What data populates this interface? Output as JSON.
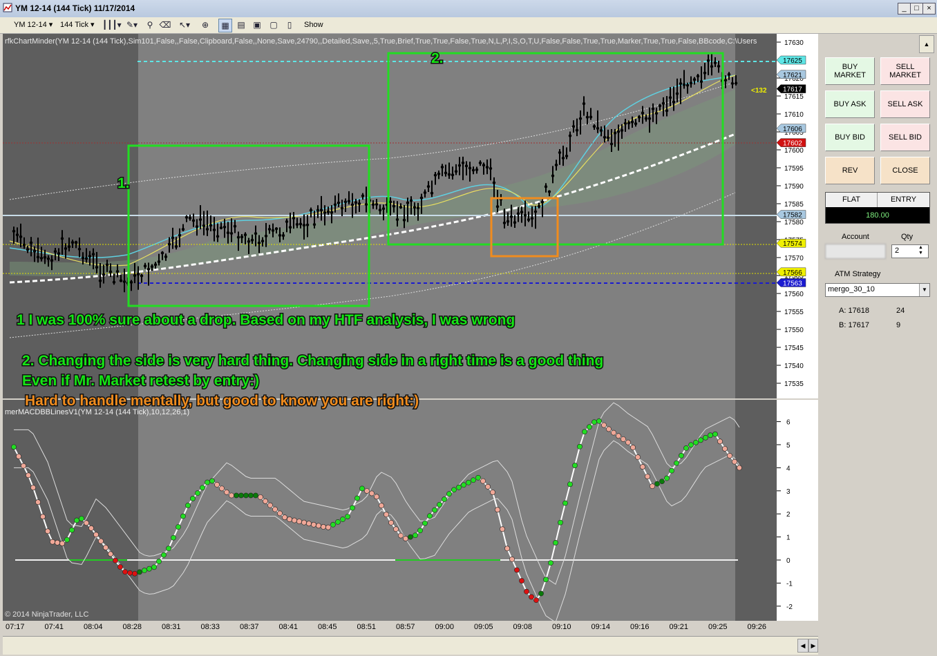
{
  "window": {
    "title": "YM 12-14 (144 Tick)  11/17/2014",
    "controls": [
      "_",
      "□",
      "×"
    ]
  },
  "toolbar": {
    "instrument": "YM 12-14",
    "period": "144 Tick",
    "show_label": "Show"
  },
  "chart": {
    "indicator_label": "rfkChartMinder(YM 12-14 (144 Tick),Sim101,False,,False,Clipboard,False,,None,Save,24790,,Detailed,Save,,5,True,Brief,True,True,False,True,N,L,P,I,S,O,T,U,False,False,True,True,Marker,True,True,False,BBcode,C:\\Users",
    "price_axis": [
      "17630",
      "17625",
      "17620",
      "17615",
      "17610",
      "17605",
      "17600",
      "17595",
      "17590",
      "17585",
      "17580",
      "17575",
      "17570",
      "17565",
      "17560",
      "17555",
      "17550",
      "17545",
      "17540",
      "17535"
    ],
    "price_flags": [
      {
        "label": "17625",
        "color": "#5ee6e6"
      },
      {
        "label": "17621",
        "color": "#a8c8e0"
      },
      {
        "label": "17617",
        "color": "#000000"
      },
      {
        "label": "17606",
        "color": "#a8c8e0"
      },
      {
        "label": "17602",
        "color": "#d01010"
      },
      {
        "label": "17582",
        "color": "#a8c8e0"
      },
      {
        "label": "17574",
        "color": "#f0f000"
      },
      {
        "label": "17566",
        "color": "#f0f000"
      },
      {
        "label": "17563",
        "color": "#1a1ad0"
      }
    ],
    "tick_counter": "<132",
    "box_labels": [
      "1.",
      "2."
    ],
    "notes": [
      {
        "text": "1 I was 100% sure about a drop. Based on my HTF analysis, I was wrong",
        "color": "#14e614"
      },
      {
        "text": "2. Changing the side is very hard thing. Changing side in a right time is a good thing",
        "color": "#14e614"
      },
      {
        "text": "Even if Mr. Market retest by entry:)",
        "color": "#14e614"
      },
      {
        "text": "Hard to handle mentally, but good to know you are right:)",
        "color": "#f08c1e"
      }
    ],
    "lower_label": "merMACDBBLinesV1(YM 12-14 (144 Tick),10,12,26,1)",
    "lower_axis": [
      "6",
      "5",
      "4",
      "3",
      "2",
      "1",
      "0",
      "-1",
      "-2"
    ],
    "copyright": "© 2014 NinjaTrader, LLC",
    "time_axis": [
      "07:17",
      "07:41",
      "08:04",
      "08:28",
      "08:31",
      "08:33",
      "08:37",
      "08:41",
      "08:45",
      "08:51",
      "08:57",
      "09:00",
      "09:05",
      "09:08",
      "09:10",
      "09:14",
      "09:16",
      "09:21",
      "09:25",
      "09:26"
    ]
  },
  "panel": {
    "buy_market": "BUY\nMARKET",
    "sell_market": "SELL\nMARKET",
    "buy_ask": "BUY ASK",
    "sell_ask": "SELL ASK",
    "buy_bid": "BUY BID",
    "sell_bid": "SELL BID",
    "rev": "REV",
    "close": "CLOSE",
    "flat": "FLAT",
    "entry": "ENTRY",
    "entry_value": "180.00",
    "account_label": "Account",
    "qty_label": "Qty",
    "qty_value": "2",
    "atm_label": "ATM Strategy",
    "atm_value": "mergo_30_10",
    "ask_label": "A: 17618",
    "ask_size": "24",
    "bid_label": "B: 17617",
    "bid_size": "9"
  },
  "colors": {
    "buy_green": "#e4f8e4",
    "sell_red": "#fbe4e4",
    "rev_close": "#f6e2c8",
    "chart_bg": "#808080",
    "chart_dark": "#5c5c5c",
    "box_green": "#22dd22",
    "box_orange": "#f08c1e"
  }
}
